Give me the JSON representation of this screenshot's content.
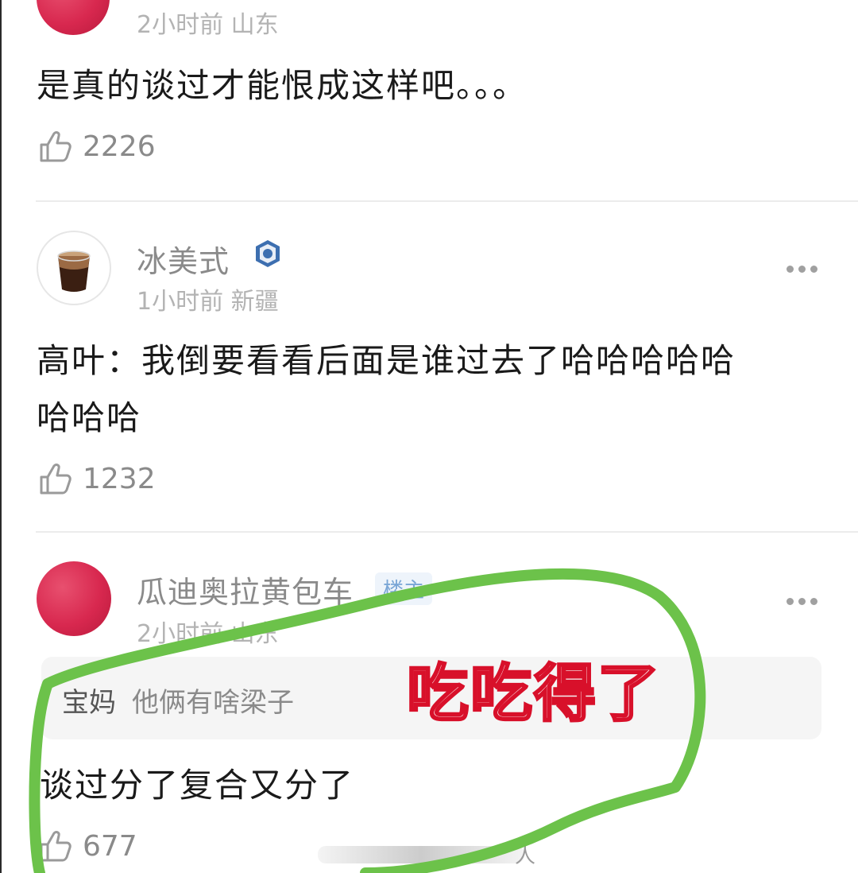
{
  "comments": [
    {
      "meta": "2小时前 山东",
      "text": "是真的谈过才能恨成这样吧。。。",
      "likes": "2226"
    },
    {
      "username": "冰美式",
      "meta": "1小时前 新疆",
      "text_line1": "高叶：我倒要看看后面是谁过去了哈哈哈哈哈",
      "text_line2": "哈哈哈",
      "likes": "1232"
    },
    {
      "username": "瓜迪奥拉黄包车",
      "badge": "楼主",
      "meta": "2小时前 山东",
      "quote_author": "宝妈",
      "quote_text": "他俩有啥梁子",
      "text": "谈过分了复合又分了",
      "likes": "677"
    }
  ],
  "annotation": {
    "text": "吃吃得了",
    "text_color": "#d8102a",
    "loop_color": "#6cc24a"
  },
  "watermark_glyph": "人",
  "icons": {
    "like": "thumbs-up-icon",
    "more": "more-dots-icon",
    "vip": "vip-badge-icon"
  }
}
